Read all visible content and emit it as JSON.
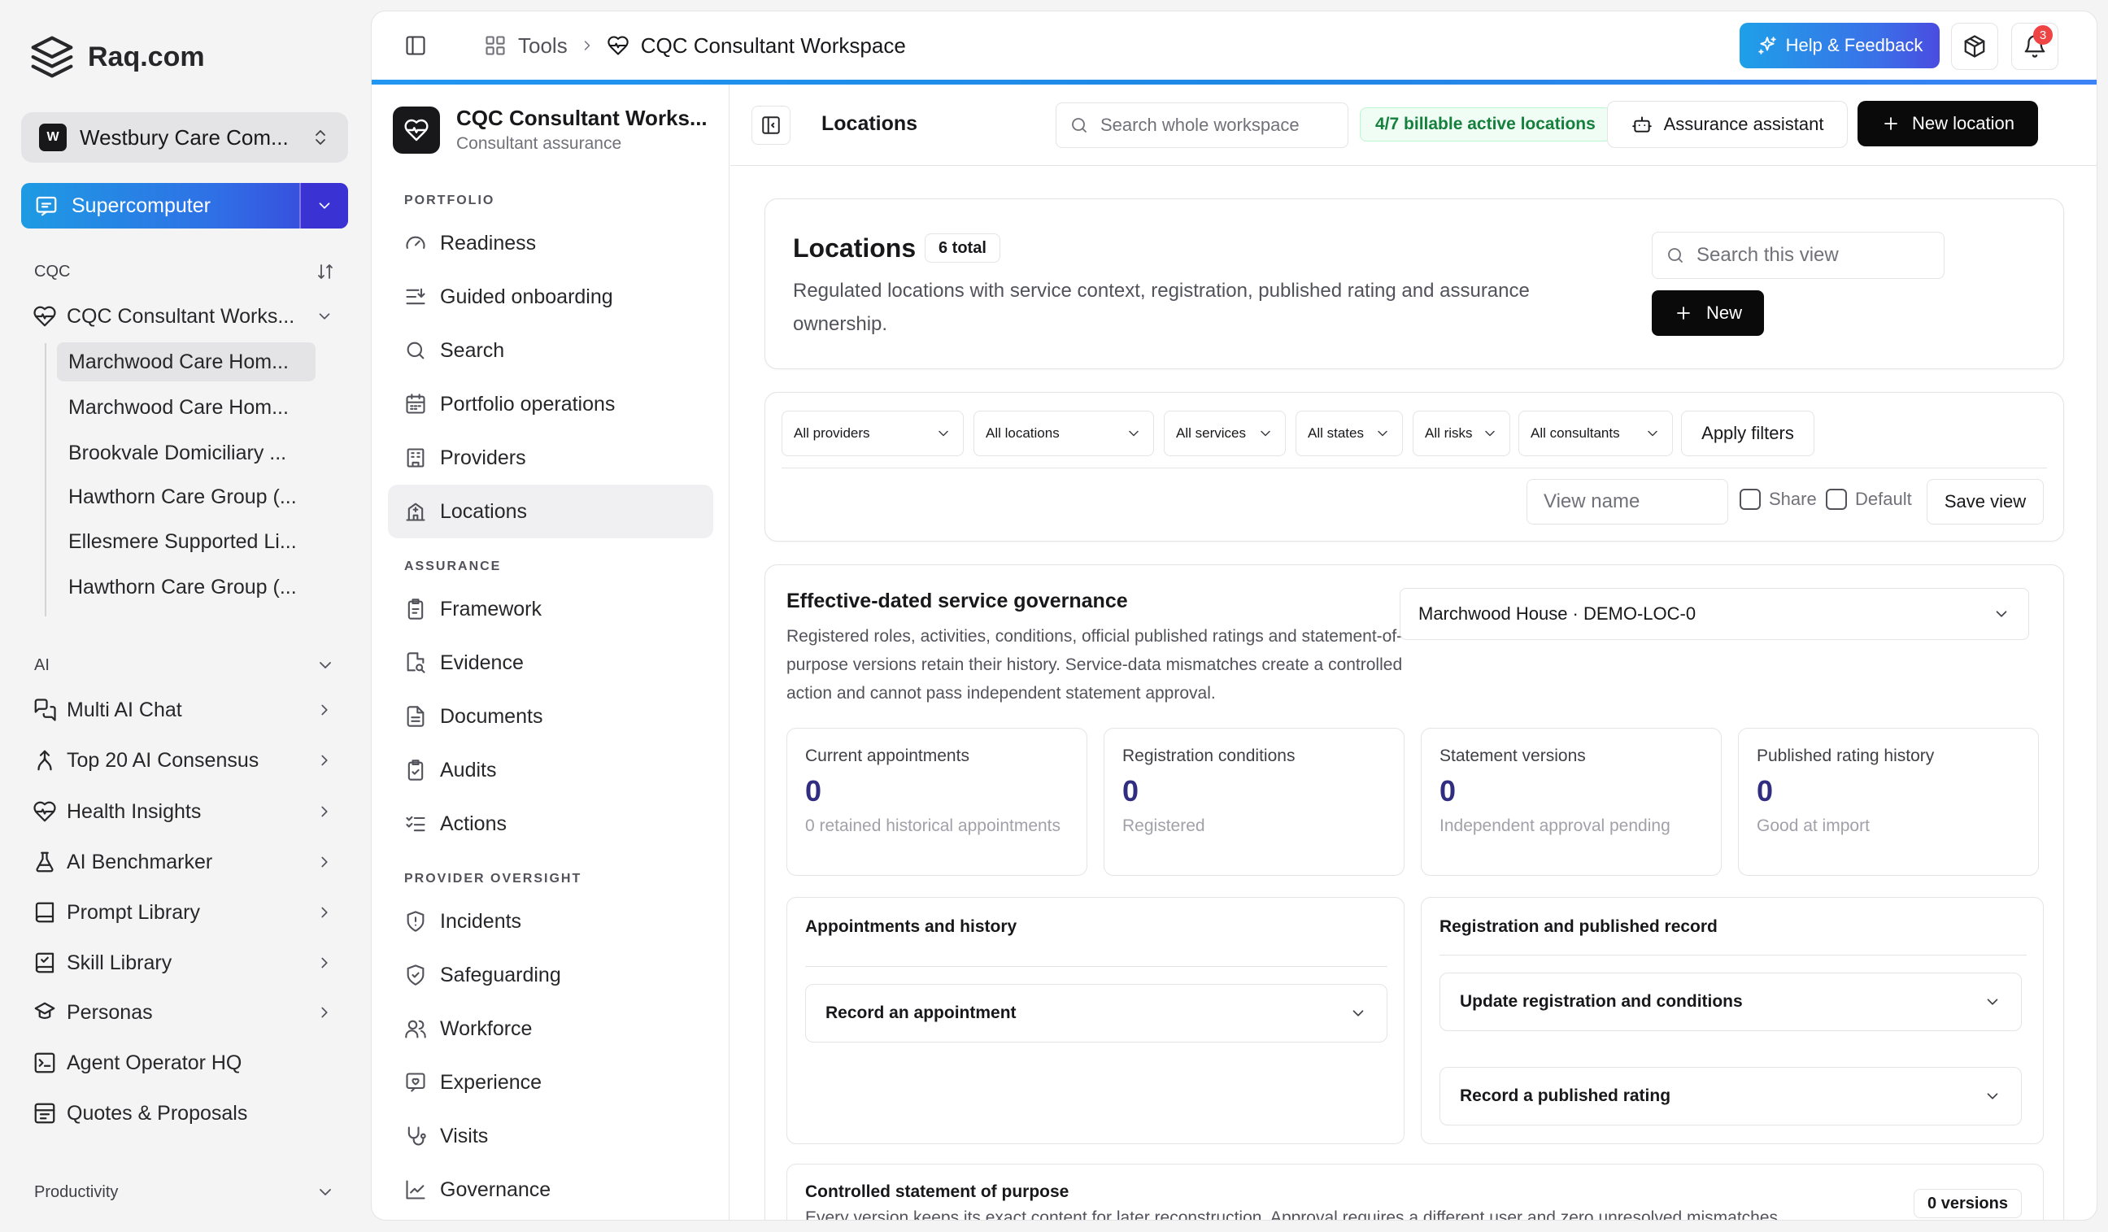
{
  "brand": {
    "name": "Raq.com"
  },
  "org": {
    "badge": "W",
    "name": "Westbury Care Com..."
  },
  "supercomputer": {
    "label": "Supercomputer"
  },
  "sidebar": {
    "cqc_section": "CQC",
    "workspace_item": "CQC Consultant Works...",
    "sub_items": [
      "Marchwood Care Hom...",
      "Marchwood Care Hom...",
      "Brookvale Domiciliary ...",
      "Hawthorn Care Group (...",
      "Ellesmere Supported Li...",
      "Hawthorn Care Group (..."
    ],
    "ai_section": "AI",
    "ai_items": [
      {
        "label": "Multi AI Chat",
        "icon": "chat-icon"
      },
      {
        "label": "Top 20 AI Consensus",
        "icon": "merge-icon"
      },
      {
        "label": "Health Insights",
        "icon": "heart-pulse-icon"
      },
      {
        "label": "AI Benchmarker",
        "icon": "flask-icon"
      },
      {
        "label": "Prompt Library",
        "icon": "book-icon"
      },
      {
        "label": "Skill Library",
        "icon": "book-check-icon"
      },
      {
        "label": "Personas",
        "icon": "persona-icon"
      },
      {
        "label": "Agent Operator HQ",
        "icon": "terminal-icon"
      },
      {
        "label": "Quotes & Proposals",
        "icon": "receipt-icon"
      }
    ],
    "productivity_section": "Productivity"
  },
  "topbar": {
    "tools": "Tools",
    "current": "CQC Consultant Workspace",
    "help_label": "Help & Feedback",
    "notif_count": "3"
  },
  "module": {
    "title": "CQC Consultant Works...",
    "subtitle": "Consultant assurance",
    "sections": {
      "portfolio": "PORTFOLIO",
      "assurance": "ASSURANCE",
      "oversight": "PROVIDER OVERSIGHT"
    },
    "portfolio_items": [
      "Readiness",
      "Guided onboarding",
      "Search",
      "Portfolio operations",
      "Providers",
      "Locations"
    ],
    "assurance_items": [
      "Framework",
      "Evidence",
      "Documents",
      "Audits",
      "Actions"
    ],
    "oversight_items": [
      "Incidents",
      "Safeguarding",
      "Workforce",
      "Experience",
      "Visits",
      "Governance"
    ]
  },
  "toolbar": {
    "title": "Locations",
    "search_placeholder": "Search whole workspace",
    "billable": "4/7 billable active locations",
    "assistant_label": "Assurance assistant",
    "new_location_label": "New location"
  },
  "locations": {
    "title": "Locations",
    "count": "6 total",
    "description": "Regulated locations with service context, registration, published rating and assurance ownership.",
    "search_placeholder": "Search this view",
    "new_label": "New"
  },
  "filters": {
    "providers": "All providers",
    "locations": "All locations",
    "services": "All services",
    "states": "All states",
    "risks": "All risks",
    "consultants": "All consultants",
    "apply_label": "Apply filters",
    "view_name_placeholder": "View name",
    "share_label": "Share",
    "default_label": "Default",
    "save_label": "Save view"
  },
  "governance": {
    "title": "Effective-dated service governance",
    "description": "Registered roles, activities, conditions, official published ratings and statement-of-purpose versions retain their history. Service-data mismatches create a controlled action and cannot pass independent statement approval.",
    "selected_location": "Marchwood House · DEMO-LOC-0",
    "stats": [
      {
        "label": "Current appointments",
        "value": "0",
        "sub": "0 retained historical appointments"
      },
      {
        "label": "Registration conditions",
        "value": "0",
        "sub": "Registered"
      },
      {
        "label": "Statement versions",
        "value": "0",
        "sub": "Independent approval pending"
      },
      {
        "label": "Published rating history",
        "value": "0",
        "sub": "Good at import"
      }
    ],
    "appointments": {
      "title": "Appointments and history",
      "record_label": "Record an appointment"
    },
    "registration": {
      "title": "Registration and published record",
      "update_label": "Update registration and conditions",
      "rating_label": "Record a published rating"
    },
    "statement": {
      "title": "Controlled statement of purpose",
      "description": "Every version keeps its exact content for later reconstruction. Approval requires a different user and zero unresolved mismatches.",
      "versions": "0 versions"
    }
  }
}
